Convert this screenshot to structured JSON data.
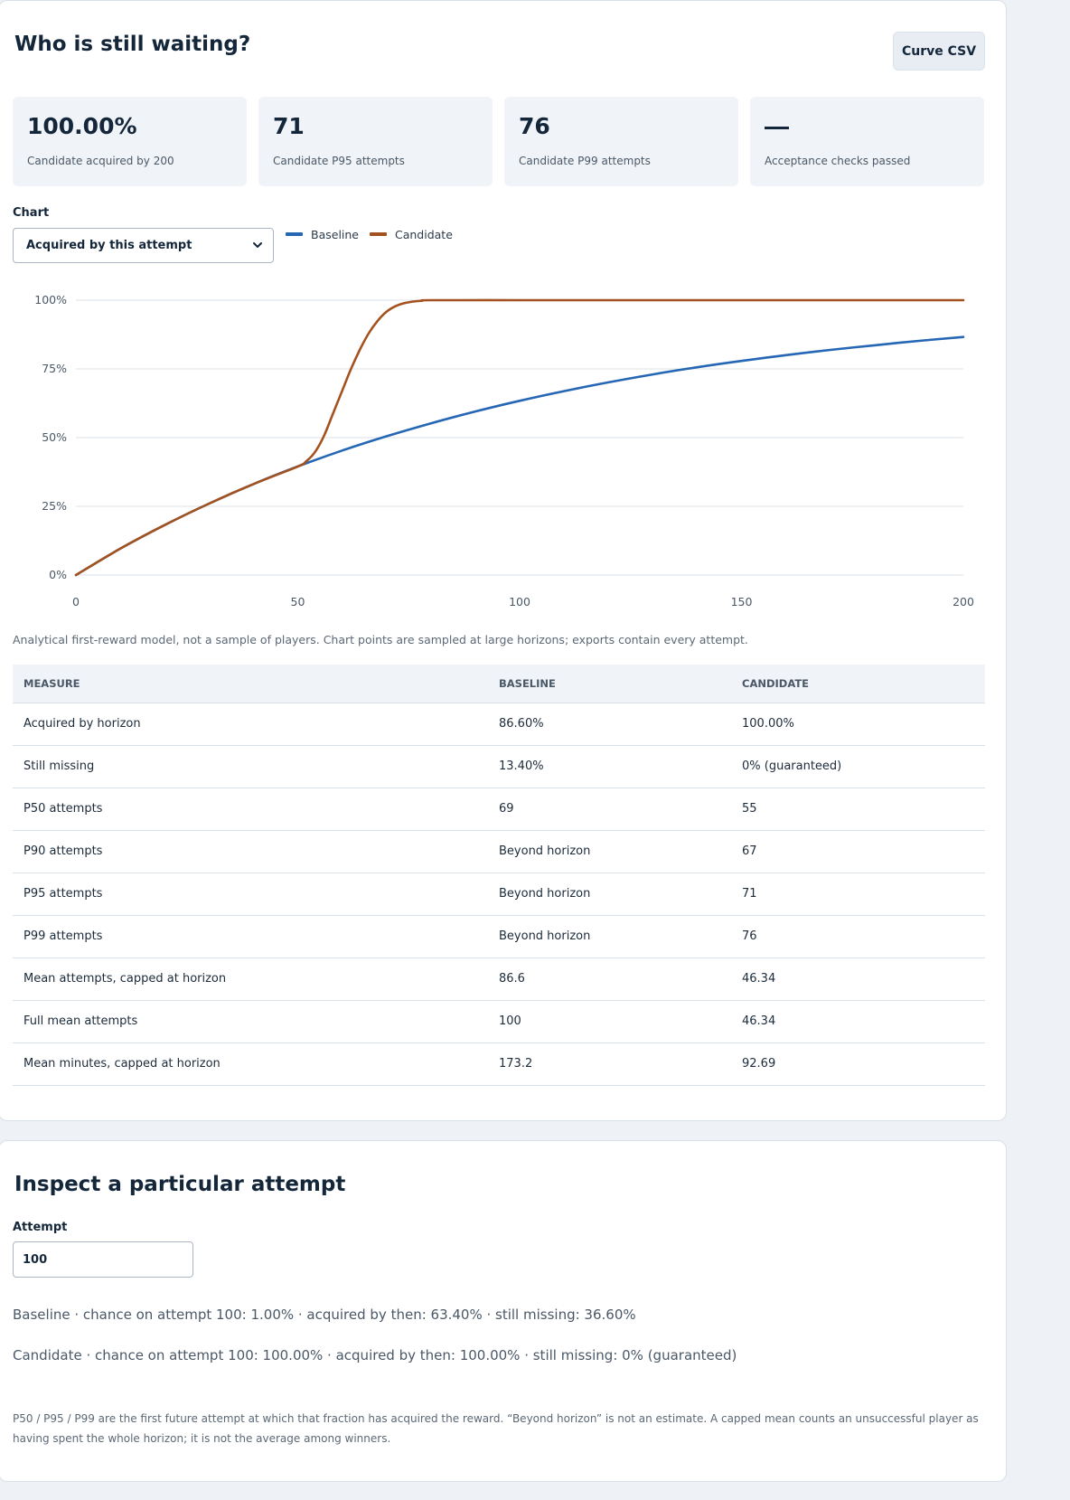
{
  "header": {
    "title": "Who is still waiting?",
    "csv_button": "Curve CSV"
  },
  "stats": [
    {
      "value": "100.00%",
      "label": "Candidate acquired by 200"
    },
    {
      "value": "71",
      "label": "Candidate P95 attempts"
    },
    {
      "value": "76",
      "label": "Candidate P99 attempts"
    },
    {
      "value": "",
      "label": "Acceptance checks passed"
    }
  ],
  "chart_control": {
    "label": "Chart",
    "selected": "Acquired by this attempt"
  },
  "colors": {
    "baseline": "#2566b5",
    "candidate": "#a3521f",
    "grid": "#dde3ea"
  },
  "chart_data": {
    "type": "line",
    "xlim": [
      0,
      200
    ],
    "ylim": [
      0,
      100
    ],
    "x_ticks": [
      "0",
      "50",
      "100",
      "150",
      "200"
    ],
    "y_ticks": [
      "0%",
      "25%",
      "50%",
      "75%",
      "100%"
    ],
    "legend_position": "top-left",
    "grid": true,
    "series": [
      {
        "name": "Baseline",
        "x": [
          0,
          10,
          20,
          30,
          40,
          50,
          60,
          70,
          80,
          90,
          100,
          110,
          120,
          130,
          140,
          150,
          160,
          170,
          180,
          190,
          200
        ],
        "y": [
          0,
          9.6,
          18.2,
          26.0,
          33.1,
          39.5,
          45.3,
          50.5,
          55.2,
          59.5,
          63.4,
          66.9,
          70.1,
          73.0,
          75.6,
          77.9,
          80.0,
          81.9,
          83.6,
          85.2,
          86.6
        ]
      },
      {
        "name": "Candidate",
        "x": [
          0,
          10,
          20,
          30,
          40,
          50,
          52,
          54,
          56,
          58,
          60,
          62,
          64,
          66,
          68,
          70,
          72,
          74,
          76,
          78,
          80,
          100,
          120,
          140,
          160,
          180,
          200
        ],
        "y": [
          0,
          9.6,
          18.2,
          26.0,
          33.1,
          39.5,
          41.5,
          45.0,
          51.0,
          59.0,
          67.0,
          75.0,
          82.0,
          88.0,
          92.5,
          95.8,
          97.8,
          98.9,
          99.5,
          99.8,
          100,
          100,
          100,
          100,
          100,
          100,
          100
        ]
      }
    ]
  },
  "caption": "Analytical first-reward model, not a sample of players. Chart points are sampled at large horizons; exports contain every attempt.",
  "table": {
    "headers": [
      "MEASURE",
      "BASELINE",
      "CANDIDATE"
    ],
    "rows": [
      [
        "Acquired by horizon",
        "86.60%",
        "100.00%"
      ],
      [
        "Still missing",
        "13.40%",
        "0% (guaranteed)"
      ],
      [
        "P50 attempts",
        "69",
        "55"
      ],
      [
        "P90 attempts",
        "Beyond horizon",
        "67"
      ],
      [
        "P95 attempts",
        "Beyond horizon",
        "71"
      ],
      [
        "P99 attempts",
        "Beyond horizon",
        "76"
      ],
      [
        "Mean attempts, capped at horizon",
        "86.6",
        "46.34"
      ],
      [
        "Full mean attempts",
        "100",
        "46.34"
      ],
      [
        "Mean minutes, capped at horizon",
        "173.2",
        "92.69"
      ]
    ]
  },
  "inspect": {
    "title": "Inspect a particular attempt",
    "attempt_label": "Attempt",
    "attempt_value": "100",
    "baseline_line": "Baseline · chance on attempt 100: 1.00% · acquired by then: 63.40% · still missing: 36.60%",
    "candidate_line": "Candidate · chance on attempt 100: 100.00% · acquired by then: 100.00% · still missing: 0% (guaranteed)",
    "footnote": "P50 / P95 / P99 are the first future attempt at which that fraction has acquired the reward. “Beyond horizon” is not an estimate. A capped mean counts an unsuccessful player as having spent the whole horizon; it is not the average among winners."
  }
}
